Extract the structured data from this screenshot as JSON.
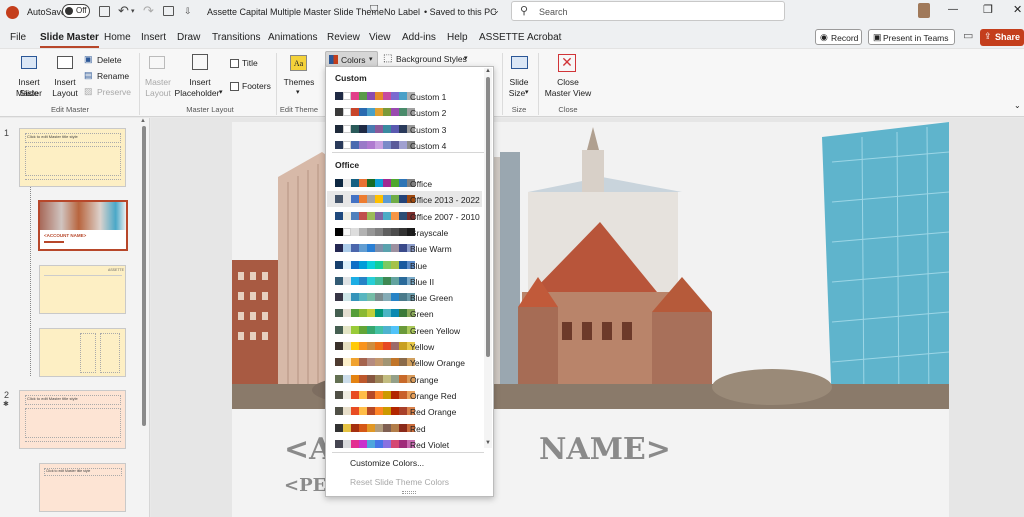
{
  "title_bar": {
    "autosave_label": "AutoSave",
    "autosave_state": "Off",
    "doc_title": "Assette Capital Multiple Master Slide Theme",
    "label_status": "No Label",
    "save_status": "• Saved to this PC",
    "search_placeholder": "Search"
  },
  "tabs": [
    "File",
    "Slide Master",
    "Home",
    "Insert",
    "Draw",
    "Transitions",
    "Animations",
    "Review",
    "View",
    "Add-ins",
    "Help",
    "ASSETTE",
    "Acrobat"
  ],
  "active_tab": "Slide Master",
  "right_buttons": {
    "record": "Record",
    "present_teams": "Present in Teams",
    "share": "Share"
  },
  "ribbon": {
    "insert_slide_master": [
      "Insert Slide",
      "Master"
    ],
    "insert_layout": [
      "Insert",
      "Layout"
    ],
    "delete": "Delete",
    "rename": "Rename",
    "preserve": "Preserve",
    "group_edit_master": "Edit Master",
    "master_layout": [
      "Master",
      "Layout"
    ],
    "insert_placeholder": [
      "Insert",
      "Placeholder"
    ],
    "title_check": "Title",
    "footers_check": "Footers",
    "group_master_layout": "Master Layout",
    "themes": "Themes",
    "group_edit_theme": "Edit Theme",
    "colors": "Colors",
    "background_styles": "Background Styles",
    "slide_size": [
      "Slide",
      "Size"
    ],
    "group_size": "Size",
    "close_master_view": [
      "Close",
      "Master View"
    ],
    "group_close": "Close"
  },
  "thumbnails": {
    "numbers": [
      "1",
      "2"
    ],
    "master_title": "Click to edit Master title style",
    "account_name": "<ACCOUNT NAME>",
    "assette": "ASSETTE"
  },
  "slide": {
    "heading_left": "<A",
    "heading_right": "NAME>",
    "subheading": "<PE"
  },
  "colors_menu": {
    "custom_header": "Custom",
    "office_header": "Office",
    "custom": [
      {
        "name": "Custom 1",
        "colors": [
          "#1f2a44",
          "#ffffff",
          "#e2408a",
          "#5a9a4a",
          "#8a4bb0",
          "#e58a2a",
          "#c74ba0",
          "#7b6ad0",
          "#4aa0c8",
          "#b0b0b0"
        ]
      },
      {
        "name": "Custom 2",
        "colors": [
          "#3a3a3a",
          "#ffffff",
          "#c8452a",
          "#2a6ab0",
          "#4aa0c8",
          "#e0a030",
          "#7a9a3a",
          "#9a4ab0",
          "#4a8a6a",
          "#a0a0a0"
        ]
      },
      {
        "name": "Custom 3",
        "colors": [
          "#1e2a3a",
          "#ffffff",
          "#2a5a5a",
          "#1f2a44",
          "#4a7ab0",
          "#8a5a9a",
          "#3a8aa0",
          "#5a5ab0",
          "#2a3a5a",
          "#9a9a9a"
        ]
      },
      {
        "name": "Custom 4",
        "colors": [
          "#2a3a5a",
          "#ffffff",
          "#4a6ab0",
          "#9a7ac8",
          "#b07ad0",
          "#c8a0e0",
          "#7a8ac8",
          "#5a5a9a",
          "#a0a0d0",
          "#8a8a8a"
        ]
      }
    ],
    "office": [
      {
        "name": "Office",
        "colors": [
          "#0e2841",
          "#e8e8e8",
          "#156082",
          "#e97132",
          "#196b24",
          "#0f9ed5",
          "#a02b93",
          "#4ea72e",
          "#2e75b6",
          "#7f7f7f"
        ]
      },
      {
        "name": "Office 2013 - 2022",
        "colors": [
          "#44546a",
          "#e7e6e6",
          "#4472c4",
          "#ed7d31",
          "#a5a5a5",
          "#ffc000",
          "#5b9bd5",
          "#70ad47",
          "#264478",
          "#9e480e"
        ]
      },
      {
        "name": "Office 2007 - 2010",
        "colors": [
          "#1f497d",
          "#eeece1",
          "#4f81bd",
          "#c0504d",
          "#9bbb59",
          "#8064a2",
          "#4bacc6",
          "#f79646",
          "#2c4d75",
          "#772c2a"
        ]
      },
      {
        "name": "Grayscale",
        "colors": [
          "#000000",
          "#f8f8f8",
          "#dddddd",
          "#b2b2b2",
          "#969696",
          "#808080",
          "#5f5f5f",
          "#4d4d4d",
          "#333333",
          "#1a1a1a"
        ]
      },
      {
        "name": "Blue Warm",
        "colors": [
          "#242852",
          "#acccea",
          "#4a66ac",
          "#629dd1",
          "#297fd5",
          "#7f8fa9",
          "#5aa2ae",
          "#9d90a0",
          "#3a4a8a",
          "#8a9ac8"
        ]
      },
      {
        "name": "Blue",
        "colors": [
          "#17406d",
          "#dbeff9",
          "#0f6fc6",
          "#009dd9",
          "#0bd0d9",
          "#10cf9b",
          "#7cca62",
          "#a5c249",
          "#1a5aa0",
          "#5a8ac8"
        ]
      },
      {
        "name": "Blue II",
        "colors": [
          "#335b74",
          "#dfe3e5",
          "#1cade4",
          "#2683c6",
          "#27ced7",
          "#42ba97",
          "#3e8853",
          "#62a39f",
          "#2a6a9a",
          "#7aaac8"
        ]
      },
      {
        "name": "Blue Green",
        "colors": [
          "#373545",
          "#cee5e7",
          "#3494ba",
          "#58b6c0",
          "#75bda7",
          "#7a8c8e",
          "#84acb6",
          "#2683c6",
          "#4a7a8a",
          "#6a9aa8"
        ]
      },
      {
        "name": "Green",
        "colors": [
          "#455f51",
          "#e3ded1",
          "#549e39",
          "#8ab833",
          "#c0cf3a",
          "#029676",
          "#4ab5c4",
          "#0989b1",
          "#3a7a3a",
          "#8aaa5a"
        ]
      },
      {
        "name": "Green Yellow",
        "colors": [
          "#455f51",
          "#e3e5c5",
          "#99cb38",
          "#63a537",
          "#37a76f",
          "#44c1a3",
          "#4eb3cf",
          "#51c3f9",
          "#6a9a3a",
          "#aac85a"
        ]
      },
      {
        "name": "Yellow",
        "colors": [
          "#39302a",
          "#e5dec0",
          "#ffca08",
          "#f8931d",
          "#ce8d3e",
          "#ec7016",
          "#e64823",
          "#9c6a6a",
          "#c8a020",
          "#e8c848"
        ]
      },
      {
        "name": "Yellow Orange",
        "colors": [
          "#4e3b30",
          "#fbeec9",
          "#f0a22e",
          "#a5644e",
          "#b58b80",
          "#c3986d",
          "#a19574",
          "#c17529",
          "#8a6a4a",
          "#d0a060"
        ]
      },
      {
        "name": "Orange",
        "colors": [
          "#637052",
          "#ccddea",
          "#e48312",
          "#bd582c",
          "#865640",
          "#9b8357",
          "#c2bc80",
          "#94a088",
          "#c86a2a",
          "#d89a5a"
        ]
      },
      {
        "name": "Orange Red",
        "colors": [
          "#505046",
          "#eeece1",
          "#e84c22",
          "#ffbd47",
          "#b64926",
          "#ff8427",
          "#cc9900",
          "#b22600",
          "#c8602a",
          "#e8a05a"
        ]
      },
      {
        "name": "Red Orange",
        "colors": [
          "#505046",
          "#e7dec9",
          "#e84c22",
          "#ffbd47",
          "#b64926",
          "#ff8427",
          "#cc9900",
          "#b22600",
          "#a8402a",
          "#d8804a"
        ]
      },
      {
        "name": "Red",
        "colors": [
          "#323232",
          "#e5c243",
          "#a5300f",
          "#d55816",
          "#e19825",
          "#b19c7d",
          "#7f5f52",
          "#b27d49",
          "#8a2a1a",
          "#c86a3a"
        ]
      },
      {
        "name": "Red Violet",
        "colors": [
          "#454551",
          "#d8d9dc",
          "#e32d91",
          "#c830cc",
          "#4ea6dc",
          "#4775e7",
          "#8971e1",
          "#d54773",
          "#a02a7a",
          "#c86ab0"
        ]
      }
    ],
    "highlighted": "Office 2013 - 2022",
    "customize": "Customize Colors...",
    "reset": "Reset Slide Theme Colors"
  }
}
